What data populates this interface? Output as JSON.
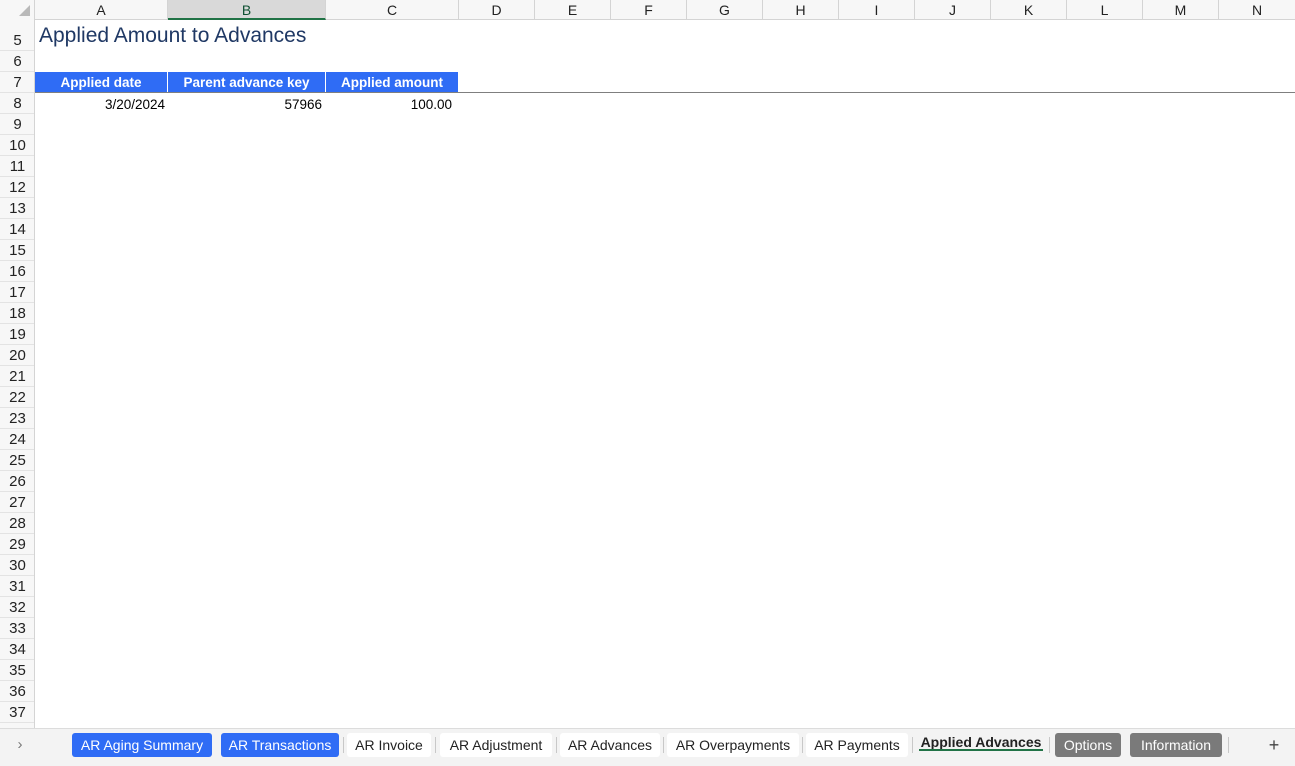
{
  "columns": [
    "A",
    "B",
    "C",
    "D",
    "E",
    "F",
    "G",
    "H",
    "I",
    "J",
    "K",
    "L",
    "M",
    "N"
  ],
  "selected_column": "B",
  "rows": [
    "5",
    "6",
    "7",
    "8",
    "9",
    "10",
    "11",
    "12",
    "13",
    "14",
    "15",
    "16",
    "17",
    "18",
    "19",
    "20",
    "21",
    "22",
    "23",
    "24",
    "25",
    "26",
    "27",
    "28",
    "29",
    "30",
    "31",
    "32",
    "33",
    "34",
    "35",
    "36",
    "37"
  ],
  "sheet": {
    "title": "Applied Amount to Advances",
    "headers": [
      "Applied date",
      "Parent advance key",
      "Applied amount"
    ],
    "row": [
      "3/20/2024",
      "57966",
      "100.00"
    ]
  },
  "colors": {
    "header_blue": "#2f6cf5",
    "title_navy": "#1f3864",
    "active_underline": "#217346",
    "gray_tab": "#7a7a7a"
  },
  "tabs": [
    {
      "label": "AR Aging Summary",
      "style": "blue"
    },
    {
      "label": "AR Transactions",
      "style": "blue"
    },
    {
      "label": "AR Invoice",
      "style": "white"
    },
    {
      "label": "AR Adjustment",
      "style": "white"
    },
    {
      "label": "AR Advances",
      "style": "white"
    },
    {
      "label": "AR Overpayments",
      "style": "white"
    },
    {
      "label": "AR Payments",
      "style": "white"
    },
    {
      "label": "Applied Advances",
      "style": "active"
    },
    {
      "label": "Options",
      "style": "gray"
    },
    {
      "label": "Information",
      "style": "gray"
    }
  ],
  "icons": {
    "scroll_tabs": "chevron-right-icon",
    "add_sheet": "plus-icon",
    "select_all": "select-all-corner-icon"
  },
  "tab_nav_glyph": "›",
  "add_sheet_glyph": "+"
}
